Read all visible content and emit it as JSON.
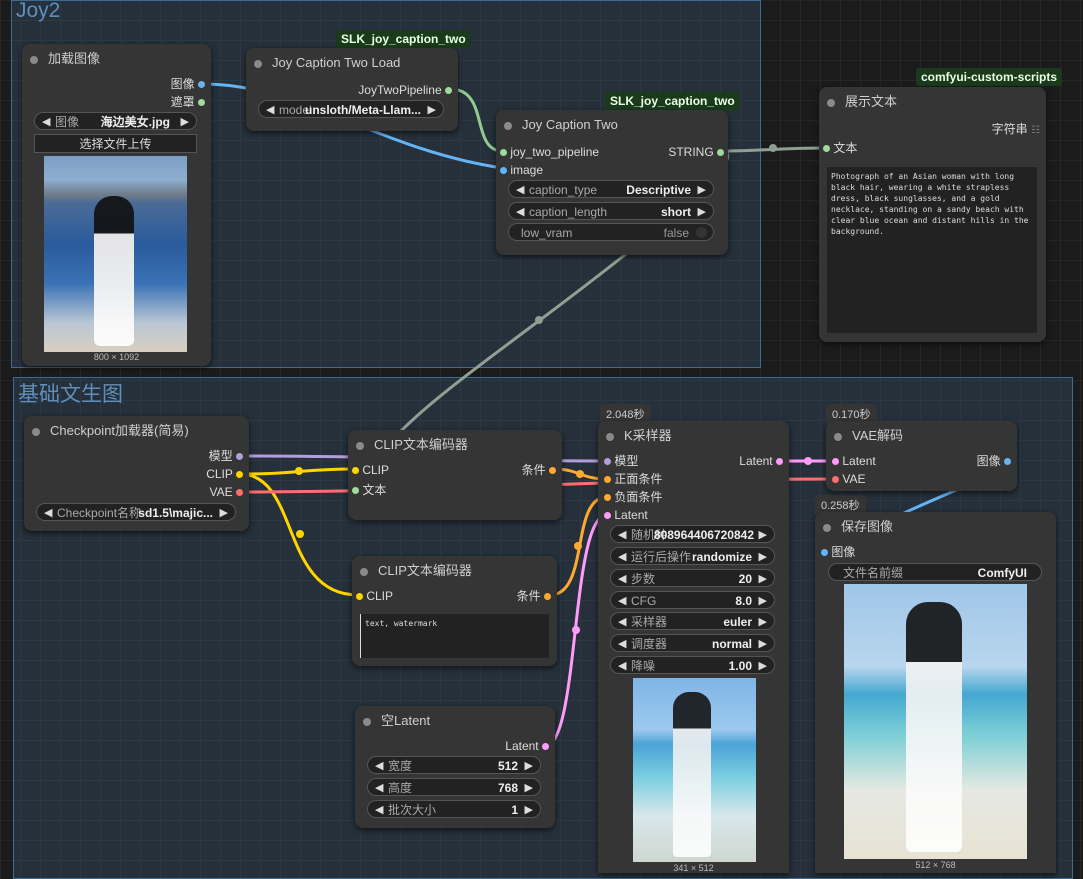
{
  "groups": {
    "joy2": "Joy2",
    "txt2img": "基础文生图"
  },
  "badges": {
    "slk1": "SLK_joy_caption_two",
    "slk2": "SLK_joy_caption_two",
    "custom": "comfyui-custom-scripts",
    "ksampler_time": "2.048秒",
    "vae_time": "0.170秒",
    "save_time": "0.258秒"
  },
  "load_image": {
    "title": "加载图像",
    "out_image": "图像",
    "out_mask": "遮罩",
    "image_label": "图像",
    "image_value": "海边美女.jpg",
    "upload_button": "选择文件上传",
    "size": "800 × 1092"
  },
  "joy_load": {
    "title": "Joy Caption Two Load",
    "out": "JoyTwoPipeline",
    "model_label": "model",
    "model_value": "unsloth/Meta-Llam..."
  },
  "joy_two": {
    "title": "Joy Caption Two",
    "in_pipeline": "joy_two_pipeline",
    "in_image": "image",
    "out_string": "STRING",
    "caption_type_label": "caption_type",
    "caption_type_value": "Descriptive",
    "caption_length_label": "caption_length",
    "caption_length_value": "short",
    "low_vram_label": "low_vram",
    "low_vram_value": "false"
  },
  "show_text": {
    "title": "展示文本",
    "out": "字符串",
    "in": "文本",
    "text": "Photograph of an Asian woman with long black hair, wearing a white strapless dress, black sunglasses, and a gold necklace, standing on a sandy beach with clear blue ocean and distant hills in the background."
  },
  "checkpoint": {
    "title": "Checkpoint加载器(简易)",
    "out_model": "模型",
    "out_clip": "CLIP",
    "out_vae": "VAE",
    "ckpt_label": "Checkpoint名称",
    "ckpt_value": "sd1.5\\majic..."
  },
  "clip1": {
    "title": "CLIP文本编码器",
    "in_clip": "CLIP",
    "in_text": "文本",
    "out": "条件"
  },
  "clip2": {
    "title": "CLIP文本编码器",
    "in_clip": "CLIP",
    "out": "条件",
    "text": "text, watermark"
  },
  "ksampler": {
    "title": "K采样器",
    "in_model": "模型",
    "in_pos": "正面条件",
    "in_neg": "负面条件",
    "in_latent": "Latent",
    "out": "Latent",
    "widgets": [
      {
        "label": "随机种",
        "value": "808964406720842"
      },
      {
        "label": "运行后操作",
        "value": "randomize"
      },
      {
        "label": "步数",
        "value": "20"
      },
      {
        "label": "CFG",
        "value": "8.0"
      },
      {
        "label": "采样器",
        "value": "euler"
      },
      {
        "label": "调度器",
        "value": "normal"
      },
      {
        "label": "降噪",
        "value": "1.00"
      }
    ],
    "size": "341 × 512"
  },
  "vae": {
    "title": "VAE解码",
    "in_latent": "Latent",
    "in_vae": "VAE",
    "out": "图像"
  },
  "save": {
    "title": "保存图像",
    "in": "图像",
    "prefix_label": "文件名前缀",
    "prefix_value": "ComfyUI",
    "size": "512 × 768"
  },
  "empty_latent": {
    "title": "空Latent",
    "out": "Latent",
    "widgets": [
      {
        "label": "宽度",
        "value": "512"
      },
      {
        "label": "高度",
        "value": "768"
      },
      {
        "label": "批次大小",
        "value": "1"
      }
    ]
  },
  "colors": {
    "model": "#b39ddb",
    "clip": "#ffd500",
    "vae": "#ff6e6e",
    "conditioning": "#ffa931",
    "latent": "#ff9cf9",
    "image": "#64b5f6",
    "string": "#9edc9c",
    "link_gray": "#8fa093"
  }
}
